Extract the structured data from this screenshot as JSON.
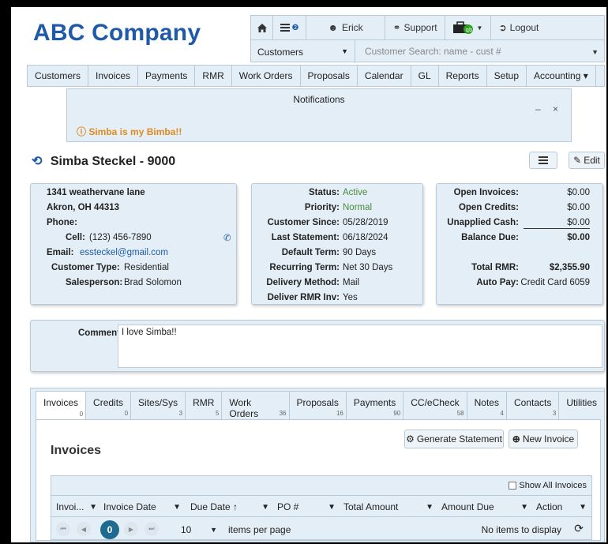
{
  "brand": {
    "logo_text": "ABC Company"
  },
  "topbar": {
    "home_icon": "home-icon",
    "list_badge": "❷",
    "user_name": "Erick",
    "support_label": "Support",
    "logout_label": "Logout",
    "customer_type_select": "Customers",
    "customer_search_placeholder": "Customer Search: name - cust #"
  },
  "nav": {
    "items": [
      "Customers",
      "Invoices",
      "Payments",
      "RMR",
      "Work Orders",
      "Proposals",
      "Calendar",
      "GL",
      "Reports",
      "Setup",
      "Accounting ▾"
    ]
  },
  "notifications": {
    "title": "Notifications",
    "controls": "– ×",
    "message": "ⓘ Simba is my Bimba!!"
  },
  "customer": {
    "title": "Simba Steckel - 9000",
    "edit_label": "Edit"
  },
  "address_card": {
    "line1": "1341 weathervane lane",
    "line2": "Akron, OH 44313",
    "phone_label": "Phone:",
    "cell_label": "Cell:",
    "cell_value": "(123) 456-7890",
    "email_label": "Email:",
    "email_value": "essteckel@gmail.com",
    "type_label": "Customer Type:",
    "type_value": "Residential",
    "sales_label": "Salesperson:",
    "sales_value": "Brad Solomon"
  },
  "status_card": {
    "status_label": "Status:",
    "status_value": "Active",
    "priority_label": "Priority:",
    "priority_value": "Normal",
    "since_label": "Customer Since:",
    "since_value": "05/28/2019",
    "last_stmt_label": "Last Statement:",
    "last_stmt_value": "06/18/2024",
    "default_term_label": "Default Term:",
    "default_term_value": "90 Days",
    "recurring_term_label": "Recurring Term:",
    "recurring_term_value": "Net 30 Days",
    "delivery_label": "Delivery Method:",
    "delivery_value": "Mail",
    "deliver_rmr_label": "Deliver RMR Inv:",
    "deliver_rmr_value": "Yes"
  },
  "balance_card": {
    "open_inv_label": "Open Invoices:",
    "open_inv_value": "$0.00",
    "open_credits_label": "Open Credits:",
    "open_credits_value": "$0.00",
    "unapplied_label": "Unapplied Cash:",
    "unapplied_value": "$0.00",
    "balance_label": "Balance Due:",
    "balance_value": "$0.00",
    "rmr_label": "Total RMR:",
    "rmr_value": "$2,355.90",
    "autopay_label": "Auto Pay:",
    "autopay_value": "Credit Card 6059"
  },
  "comments": {
    "label": "Comments",
    "text": "I love Simba!!"
  },
  "tabs": [
    {
      "label": "Invoices",
      "count": "0"
    },
    {
      "label": "Credits",
      "count": "0"
    },
    {
      "label": "Sites/Sys",
      "count": "3"
    },
    {
      "label": "RMR",
      "count": "5"
    },
    {
      "label": "Work Orders",
      "count": "36"
    },
    {
      "label": "Proposals",
      "count": "16"
    },
    {
      "label": "Payments",
      "count": "90"
    },
    {
      "label": "CC/eCheck",
      "count": "58"
    },
    {
      "label": "Notes",
      "count": "4"
    },
    {
      "label": "Contacts",
      "count": "3"
    },
    {
      "label": "Utilities",
      "count": ""
    }
  ],
  "invoices_panel": {
    "heading": "Invoices",
    "generate_statement_label": "Generate Statement",
    "new_invoice_label": "New Invoice",
    "show_all_label": "Show All Invoices",
    "columns": [
      "Invoi...",
      "Invoice Date",
      "Due Date ↑",
      "PO #",
      "Total Amount",
      "Amount Due",
      "Action"
    ],
    "current_page": "0",
    "page_size": "10",
    "items_per_page_label": "items per page",
    "empty_label": "No items to display"
  }
}
